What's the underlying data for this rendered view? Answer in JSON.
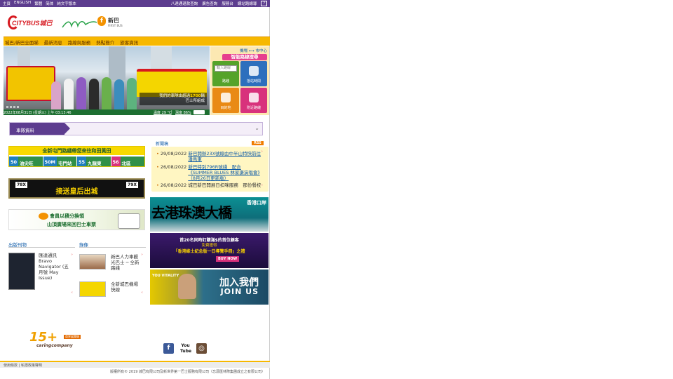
{
  "topbar": {
    "home": "主頁",
    "english": "ENGLISH",
    "trad": "繁體",
    "simp": "简体",
    "plain": "純文字版本",
    "octopus": "八達通退款查詢",
    "ad": "廣告查詢",
    "service": "服務台",
    "sitemap": "網站路線導",
    "help": "?"
  },
  "logos": {
    "citybus": "CITYBUS城巴",
    "firstbus_name": "新巴",
    "firstbus_sub": "FIRST BUS"
  },
  "nav": [
    "城巴/新巴全面睇",
    "最新消息",
    "路線與服務",
    "熱點簡介",
    "旅客資訊"
  ],
  "hero": {
    "caption_line1_pre": "我們的車隊由超過",
    "caption_num": "1700",
    "caption_line1_post": "輛",
    "caption_line2": "巴士所組成"
  },
  "datebar": {
    "datetime": "2022年08月31日 (星期三) 上午 03:13:46",
    "temp": "溫度 29 °C",
    "sep": "|",
    "humidity": "濕度 86%"
  },
  "smart": {
    "airport": "機場 ⟷ 市中心",
    "title": "智能路線搜尋",
    "route_placeholder": "輸入路線",
    "route_label": "路綫",
    "arrival_label": "抵站時間",
    "destination_label": "目的地",
    "nearby_label": "附近路綫"
  },
  "fleet": {
    "label": "車隊資料"
  },
  "banners": {
    "b1_head": "全新屯門路綫帶您來往和田黃田",
    "b1_chips": [
      {
        "num": "50",
        "stop": "油尖旺",
        "color": "#1f7fbf"
      },
      {
        "num": "50M",
        "stop": "屯門站",
        "color": "#1f7fbf"
      },
      {
        "num": "55",
        "stop": "九龍東",
        "color": "#1f7fbf"
      },
      {
        "num": "56",
        "stop": "北區",
        "color": "#d8327c"
      }
    ],
    "b2_left": "78X",
    "b2_text": "接送皇后出城",
    "b2_right": "79X",
    "b3_line1": "會員以積分換領",
    "b3_line2": "山頂廣場來回巴士車票"
  },
  "publications": {
    "title": "出版刊物",
    "mag_title": "匯達通訊 Bravo Navigator (五月號 May Issue)"
  },
  "videos": {
    "title": "錄像",
    "v1": "新巴人力車觀光巴士 ─ 全新路綫",
    "v2": "全新城巴機場快線"
  },
  "news": {
    "heading": "新聞稿",
    "rss": "RSS",
    "items": [
      {
        "date": "29/08/2022",
        "text": "新巴開辦23X號線由中半山特快前往潘鳥東"
      },
      {
        "date": "26/08/2022",
        "text": "新巴特別796R號綫　配合《SUMMER BLUES 林家謙演唱會》（8月26日更新版）"
      },
      {
        "date": "26/08/2022",
        "text": "城巴新巴開展日扣咪服務　那份餐校"
      }
    ]
  },
  "right_banners": {
    "rb1_text": "去港珠澳大橋",
    "rb1_port": "香港口岸",
    "rb2_line1": "首20名同時訂購滿$的首位顧客",
    "rb2_line2": "免費獲得",
    "rb2_line3": "「香港維士紀念版一日導覽手冊」之禮",
    "rb2_buy": "BUY NOW",
    "rb3_line1": "加入我們",
    "rb3_line2": "JOIN US",
    "rb3_you": "YOU VITALITY"
  },
  "footer": {
    "caring_num": "15+",
    "caring_text": "caringcompany",
    "caring_badge": "商界展關懷",
    "facebook": "f",
    "youtube": "You Tube",
    "instagram": "◎",
    "links": "使用條款 | 私隱政策聲明",
    "copyright": "版權所有© 2019 城巴有限公司及新世界第一巴士服務有限公司（忘源匯林際集團成立之有限公司）"
  }
}
